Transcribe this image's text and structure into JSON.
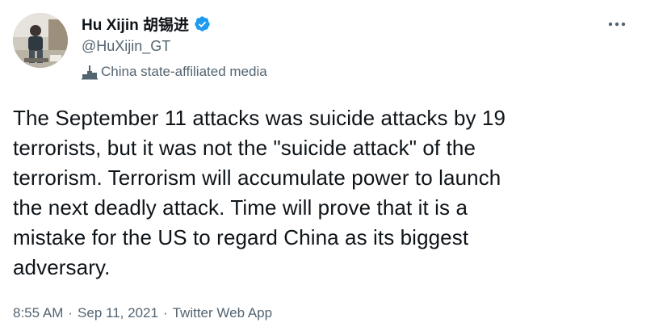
{
  "author": {
    "display_name": "Hu Xijin 胡锡进",
    "handle": "@HuXijin_GT",
    "verified_icon": "verified-badge-icon",
    "label_icon": "state-media-podium-icon",
    "label": "China state-affiliated media"
  },
  "tweet": {
    "text": "The September 11 attacks was suicide attacks by 19\nterrorists, but it was not the \"suicide attack\" of the\nterrorism. Terrorism will accumulate power to launch\nthe next deadly attack. Time will prove that it is a\nmistake for the US to regard China as its biggest\nadversary."
  },
  "meta": {
    "time": "8:55 AM",
    "date": "Sep 11, 2021",
    "source": "Twitter Web App",
    "separator": "·"
  },
  "menu": {
    "more_icon": "more-dots-icon"
  },
  "colors": {
    "text_primary": "#0f1419",
    "text_secondary": "#536471",
    "verified_blue": "#1d9bf0"
  }
}
